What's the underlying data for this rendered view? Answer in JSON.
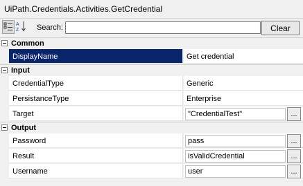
{
  "title": "UiPath.Credentials.Activities.GetCredential",
  "toolbar": {
    "search_label": "Search:",
    "search_value": "",
    "clear_label": "Clear"
  },
  "categories": [
    {
      "label": "Common",
      "rows": [
        {
          "name": "DisplayName",
          "value": "Get credential",
          "selected": true,
          "editor": false
        }
      ]
    },
    {
      "label": "Input",
      "rows": [
        {
          "name": "CredentialType",
          "value": "Generic",
          "editor": false
        },
        {
          "name": "PersistanceType",
          "value": "Enterprise",
          "editor": false
        },
        {
          "name": "Target",
          "value": "\"CredentialTest\"",
          "editor": true
        }
      ]
    },
    {
      "label": "Output",
      "rows": [
        {
          "name": "Password",
          "value": "pass",
          "editor": true
        },
        {
          "name": "Result",
          "value": "isValidCredential",
          "editor": true
        },
        {
          "name": "Username",
          "value": "user",
          "editor": true
        }
      ]
    }
  ],
  "ellipsis_label": "...",
  "icons": [
    "categorized-icon",
    "sort-alphabetical-icon",
    "collapse-icon"
  ]
}
